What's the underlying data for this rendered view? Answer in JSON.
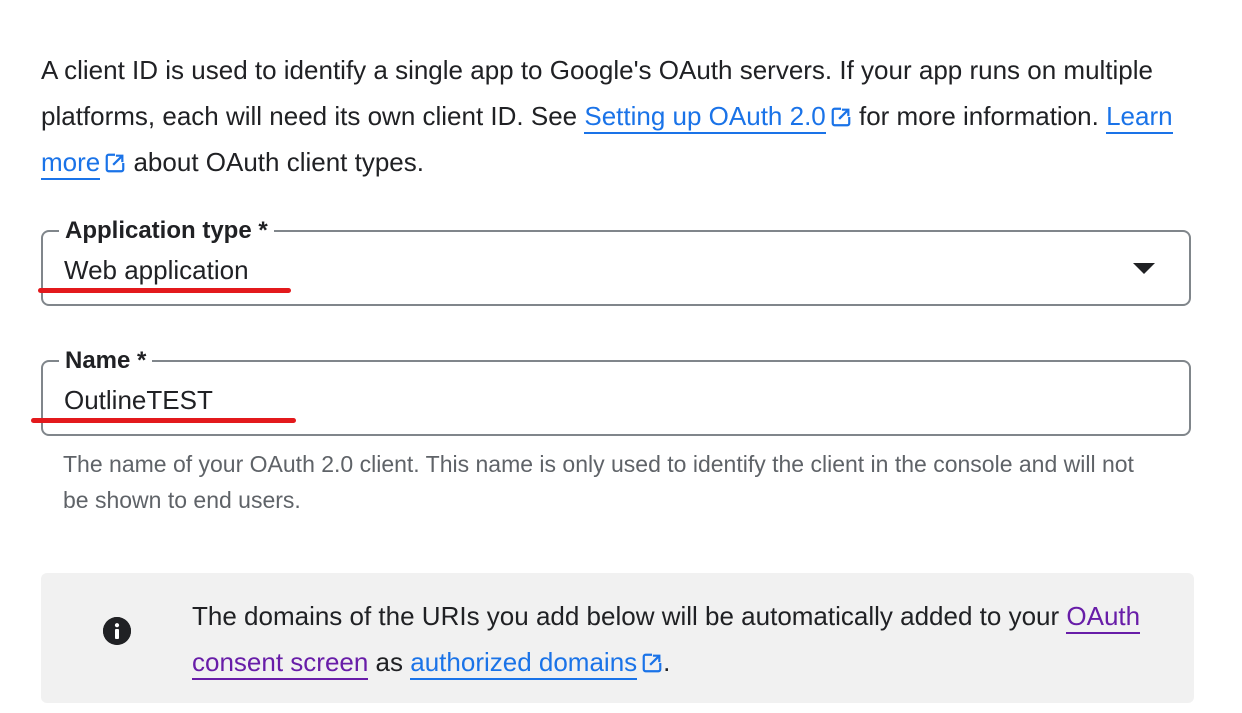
{
  "intro": {
    "text_before_link1": "A client ID is used to identify a single app to Google's OAuth servers. If your app runs on multiple platforms, each will need its own client ID. See ",
    "link1": "Setting up OAuth 2.0",
    "text_after_link1": " for more information. ",
    "link2": "Learn more",
    "text_after_link2": " about OAuth client types."
  },
  "application_type": {
    "label": "Application type *",
    "value": "Web application"
  },
  "name_field": {
    "label": "Name *",
    "value": "OutlineTEST",
    "helper": "The name of your OAuth 2.0 client. This name is only used to identify the client in the console and will not be shown to end users."
  },
  "info_notice": {
    "text_before": "The domains of the URIs you add below will be automatically added to your ",
    "link1": "OAuth consent screen",
    "text_middle": " as ",
    "link2": "authorized domains",
    "text_after": "."
  },
  "colors": {
    "link": "#1a73e8",
    "visited_link": "#681da8",
    "annotation_red": "#e3191c",
    "info_background": "#f1f1f1"
  },
  "icons": {
    "external_link": "open-in-new-icon",
    "dropdown": "triangle-down-icon",
    "info": "info-circle-icon"
  }
}
